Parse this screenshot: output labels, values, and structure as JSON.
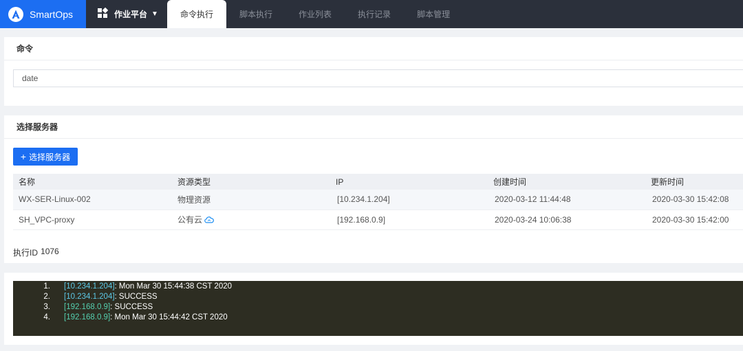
{
  "brand": {
    "name": "SmartOps",
    "color": "#1c6ef2"
  },
  "platform": {
    "label": "作业平台",
    "icon": "grid-icon",
    "caret": "caret-down-icon"
  },
  "tabs": [
    {
      "label": "命令执行",
      "active": true
    },
    {
      "label": "脚本执行",
      "active": false
    },
    {
      "label": "作业列表",
      "active": false
    },
    {
      "label": "执行记录",
      "active": false
    },
    {
      "label": "脚本管理",
      "active": false
    }
  ],
  "command": {
    "title": "命令",
    "value": "date"
  },
  "servers": {
    "title": "选择服务器",
    "button_label": "选择服务器",
    "columns": [
      "名称",
      "资源类型",
      "IP",
      "创建时间",
      "更新时间"
    ],
    "rows": [
      {
        "name": "WX-SER-Linux-002",
        "type": "物理资源",
        "ip": "[10.234.1.204]",
        "created": "2020-03-12 11:44:48",
        "updated": "2020-03-30 15:42:08"
      },
      {
        "name": "SH_VPC-proxy",
        "type": "公有云",
        "ip": "[192.168.0.9]",
        "created": "2020-03-24 10:06:38",
        "updated": "2020-03-30 15:42:00"
      }
    ]
  },
  "execution": {
    "label": "执行ID",
    "id": "1076"
  },
  "log": [
    {
      "num": "1.",
      "ip": "[10.234.1.204]",
      "text": ": Mon Mar 30 15:44:38 CST 2020"
    },
    {
      "num": "2.",
      "ip": "[10.234.1.204]",
      "text": ": SUCCESS"
    },
    {
      "num": "3.",
      "ip": "[192.168.0.9]",
      "text": ": SUCCESS"
    },
    {
      "num": "4.",
      "ip": "[192.168.0.9]",
      "text": ": Mon Mar 30 15:44:42 CST 2020"
    }
  ]
}
